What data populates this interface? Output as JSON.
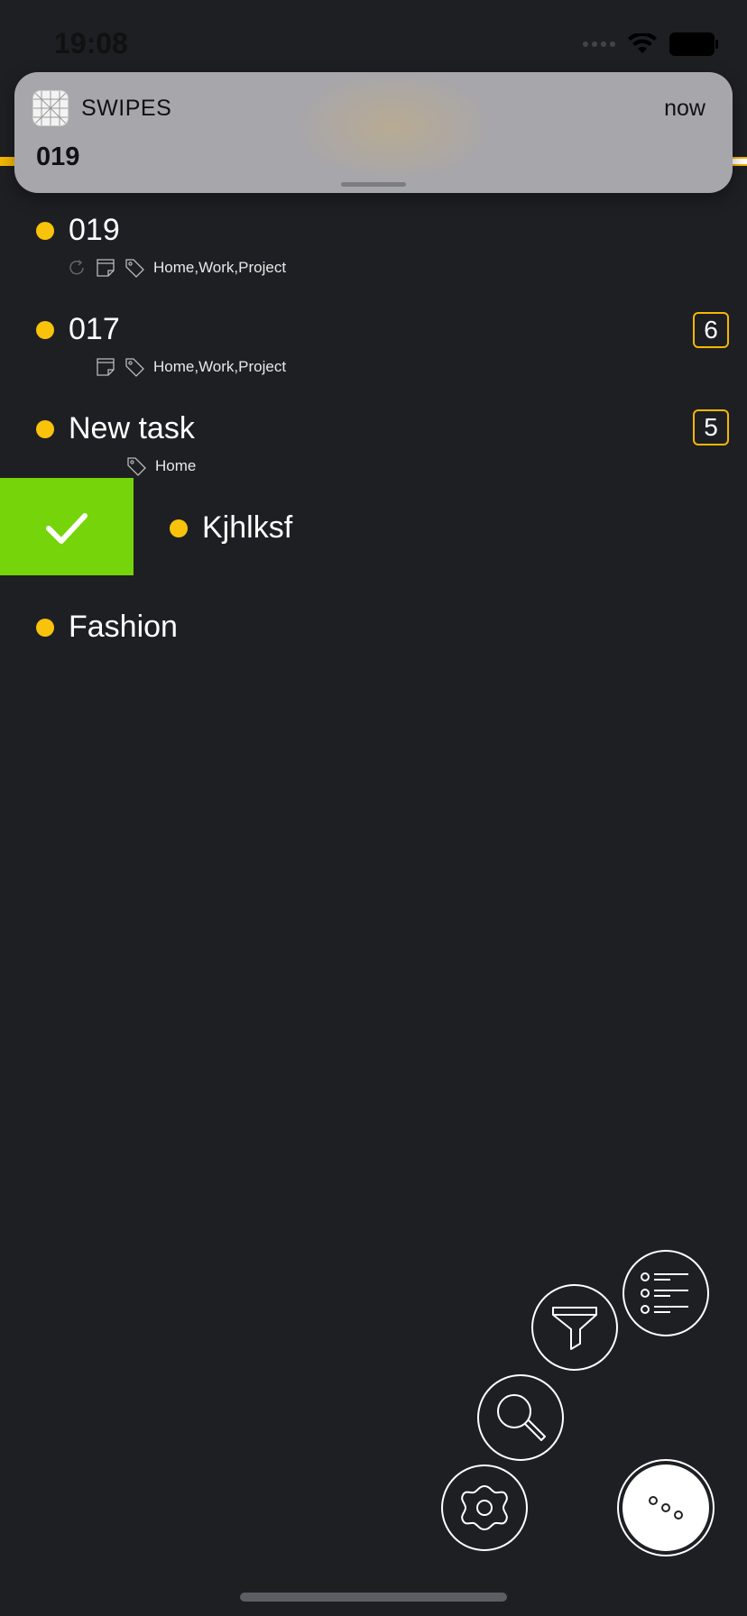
{
  "status_bar": {
    "time": "19:08"
  },
  "notification": {
    "app_name": "SWIPES",
    "time": "now",
    "title": "019"
  },
  "tasks": [
    {
      "title": "019",
      "tags": "Home,Work,Project"
    },
    {
      "title": "017",
      "tags": "Home,Work,Project",
      "badge": "6"
    },
    {
      "title": "New task",
      "tags": "Home",
      "badge": "5"
    },
    {
      "title": "Kjhlksf"
    },
    {
      "title": "Fashion"
    }
  ],
  "colors": {
    "accent": "#f9c20b",
    "complete_green": "#76d40a",
    "background": "#1e1f23"
  },
  "icons": {
    "fab_list": "list-icon",
    "fab_filter": "filter-icon",
    "fab_search": "search-icon",
    "fab_settings": "gear-icon",
    "fab_menu": "more-icon"
  }
}
